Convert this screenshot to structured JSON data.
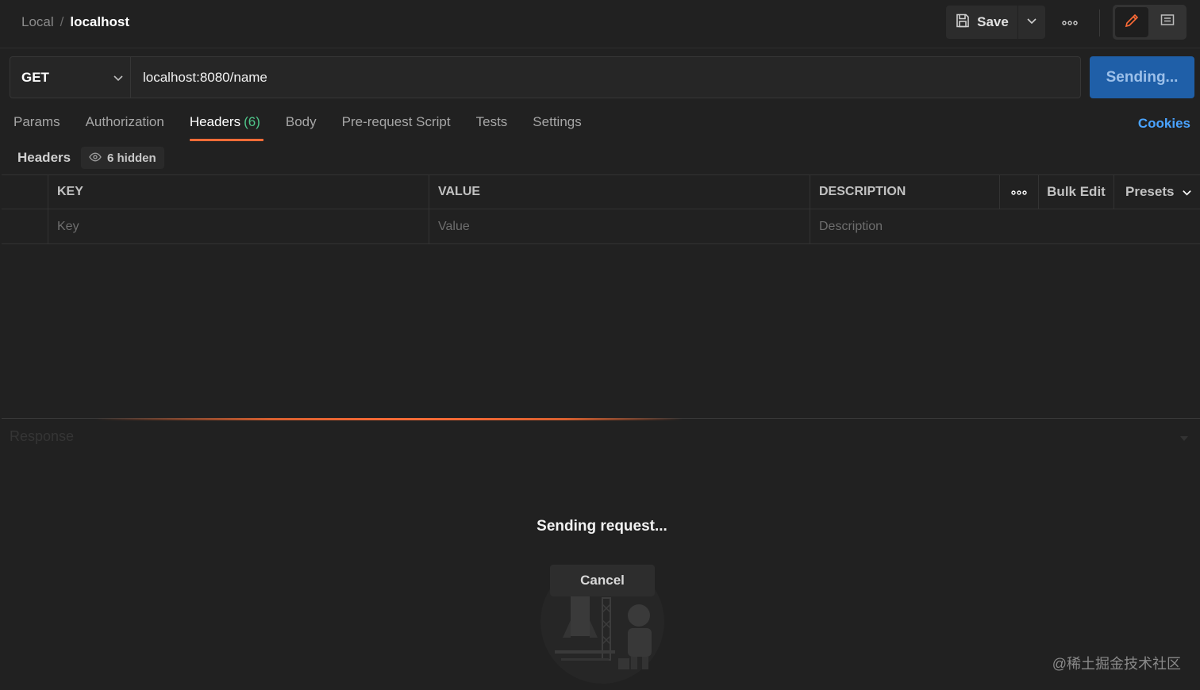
{
  "breadcrumb": {
    "parent": "Local",
    "separator": "/",
    "current": "localhost"
  },
  "toolbar": {
    "save_label": "Save"
  },
  "request": {
    "method": "GET",
    "url": "localhost:8080/name",
    "send_label": "Sending..."
  },
  "tabs": [
    {
      "label": "Params"
    },
    {
      "label": "Authorization"
    },
    {
      "label": "Headers",
      "count": "(6)"
    },
    {
      "label": "Body"
    },
    {
      "label": "Pre-request Script"
    },
    {
      "label": "Tests"
    },
    {
      "label": "Settings"
    }
  ],
  "cookies_label": "Cookies",
  "headers": {
    "label": "Headers",
    "hidden_label": "6 hidden",
    "columns": {
      "key": "KEY",
      "value": "VALUE",
      "description": "DESCRIPTION"
    },
    "bulk_edit_label": "Bulk Edit",
    "presets_label": "Presets",
    "placeholders": {
      "key": "Key",
      "value": "Value",
      "description": "Description"
    }
  },
  "response": {
    "label": "Response",
    "status_text": "Sending request...",
    "cancel_label": "Cancel"
  },
  "watermark": "@稀土掘金技术社区",
  "colors": {
    "accent": "#ff6c37",
    "primary": "#1f5fa8",
    "link": "#4aa3ff",
    "success": "#4fc68a"
  }
}
